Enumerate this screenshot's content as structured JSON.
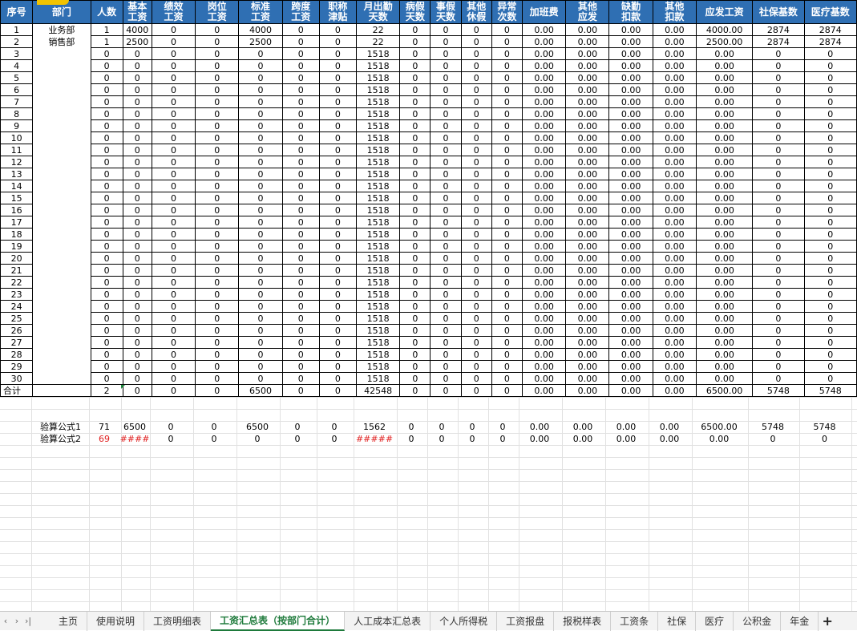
{
  "header": {
    "cols": [
      [
        "序号"
      ],
      [
        "部门"
      ],
      [
        "人数"
      ],
      [
        "基本",
        "工资"
      ],
      [
        "绩效",
        "工资"
      ],
      [
        "岗位",
        "工资"
      ],
      [
        "标准",
        "工资"
      ],
      [
        "跨度",
        "工资"
      ],
      [
        "职称",
        "津贴"
      ],
      [
        "月出勤",
        "天数"
      ],
      [
        "病假",
        "天数"
      ],
      [
        "事假",
        "天数"
      ],
      [
        "其他",
        "休假"
      ],
      [
        "异常",
        "次数"
      ],
      [
        "加班费"
      ],
      [
        "其他",
        "应发"
      ],
      [
        "缺勤",
        "扣款"
      ],
      [
        "其他",
        "扣款"
      ],
      [
        "应发工资"
      ],
      [
        "社保基数"
      ],
      [
        "医疗基数"
      ]
    ]
  },
  "rows": [
    [
      "1",
      "业务部",
      "1",
      "4000",
      "0",
      "0",
      "4000",
      "0",
      "0",
      "22",
      "0",
      "0",
      "0",
      "0",
      "0.00",
      "0.00",
      "0.00",
      "0.00",
      "4000.00",
      "2874",
      "2874"
    ],
    [
      "2",
      "销售部",
      "1",
      "2500",
      "0",
      "0",
      "2500",
      "0",
      "0",
      "22",
      "0",
      "0",
      "0",
      "0",
      "0.00",
      "0.00",
      "0.00",
      "0.00",
      "2500.00",
      "2874",
      "2874"
    ],
    [
      "3",
      "",
      "0",
      "0",
      "0",
      "0",
      "0",
      "0",
      "0",
      "1518",
      "0",
      "0",
      "0",
      "0",
      "0.00",
      "0.00",
      "0.00",
      "0.00",
      "0.00",
      "0",
      "0"
    ],
    [
      "4",
      "",
      "0",
      "0",
      "0",
      "0",
      "0",
      "0",
      "0",
      "1518",
      "0",
      "0",
      "0",
      "0",
      "0.00",
      "0.00",
      "0.00",
      "0.00",
      "0.00",
      "0",
      "0"
    ],
    [
      "5",
      "",
      "0",
      "0",
      "0",
      "0",
      "0",
      "0",
      "0",
      "1518",
      "0",
      "0",
      "0",
      "0",
      "0.00",
      "0.00",
      "0.00",
      "0.00",
      "0.00",
      "0",
      "0"
    ],
    [
      "6",
      "",
      "0",
      "0",
      "0",
      "0",
      "0",
      "0",
      "0",
      "1518",
      "0",
      "0",
      "0",
      "0",
      "0.00",
      "0.00",
      "0.00",
      "0.00",
      "0.00",
      "0",
      "0"
    ],
    [
      "7",
      "",
      "0",
      "0",
      "0",
      "0",
      "0",
      "0",
      "0",
      "1518",
      "0",
      "0",
      "0",
      "0",
      "0.00",
      "0.00",
      "0.00",
      "0.00",
      "0.00",
      "0",
      "0"
    ],
    [
      "8",
      "",
      "0",
      "0",
      "0",
      "0",
      "0",
      "0",
      "0",
      "1518",
      "0",
      "0",
      "0",
      "0",
      "0.00",
      "0.00",
      "0.00",
      "0.00",
      "0.00",
      "0",
      "0"
    ],
    [
      "9",
      "",
      "0",
      "0",
      "0",
      "0",
      "0",
      "0",
      "0",
      "1518",
      "0",
      "0",
      "0",
      "0",
      "0.00",
      "0.00",
      "0.00",
      "0.00",
      "0.00",
      "0",
      "0"
    ],
    [
      "10",
      "",
      "0",
      "0",
      "0",
      "0",
      "0",
      "0",
      "0",
      "1518",
      "0",
      "0",
      "0",
      "0",
      "0.00",
      "0.00",
      "0.00",
      "0.00",
      "0.00",
      "0",
      "0"
    ],
    [
      "11",
      "",
      "0",
      "0",
      "0",
      "0",
      "0",
      "0",
      "0",
      "1518",
      "0",
      "0",
      "0",
      "0",
      "0.00",
      "0.00",
      "0.00",
      "0.00",
      "0.00",
      "0",
      "0"
    ],
    [
      "12",
      "",
      "0",
      "0",
      "0",
      "0",
      "0",
      "0",
      "0",
      "1518",
      "0",
      "0",
      "0",
      "0",
      "0.00",
      "0.00",
      "0.00",
      "0.00",
      "0.00",
      "0",
      "0"
    ],
    [
      "13",
      "",
      "0",
      "0",
      "0",
      "0",
      "0",
      "0",
      "0",
      "1518",
      "0",
      "0",
      "0",
      "0",
      "0.00",
      "0.00",
      "0.00",
      "0.00",
      "0.00",
      "0",
      "0"
    ],
    [
      "14",
      "",
      "0",
      "0",
      "0",
      "0",
      "0",
      "0",
      "0",
      "1518",
      "0",
      "0",
      "0",
      "0",
      "0.00",
      "0.00",
      "0.00",
      "0.00",
      "0.00",
      "0",
      "0"
    ],
    [
      "15",
      "",
      "0",
      "0",
      "0",
      "0",
      "0",
      "0",
      "0",
      "1518",
      "0",
      "0",
      "0",
      "0",
      "0.00",
      "0.00",
      "0.00",
      "0.00",
      "0.00",
      "0",
      "0"
    ],
    [
      "16",
      "",
      "0",
      "0",
      "0",
      "0",
      "0",
      "0",
      "0",
      "1518",
      "0",
      "0",
      "0",
      "0",
      "0.00",
      "0.00",
      "0.00",
      "0.00",
      "0.00",
      "0",
      "0"
    ],
    [
      "17",
      "",
      "0",
      "0",
      "0",
      "0",
      "0",
      "0",
      "0",
      "1518",
      "0",
      "0",
      "0",
      "0",
      "0.00",
      "0.00",
      "0.00",
      "0.00",
      "0.00",
      "0",
      "0"
    ],
    [
      "18",
      "",
      "0",
      "0",
      "0",
      "0",
      "0",
      "0",
      "0",
      "1518",
      "0",
      "0",
      "0",
      "0",
      "0.00",
      "0.00",
      "0.00",
      "0.00",
      "0.00",
      "0",
      "0"
    ],
    [
      "19",
      "",
      "0",
      "0",
      "0",
      "0",
      "0",
      "0",
      "0",
      "1518",
      "0",
      "0",
      "0",
      "0",
      "0.00",
      "0.00",
      "0.00",
      "0.00",
      "0.00",
      "0",
      "0"
    ],
    [
      "20",
      "",
      "0",
      "0",
      "0",
      "0",
      "0",
      "0",
      "0",
      "1518",
      "0",
      "0",
      "0",
      "0",
      "0.00",
      "0.00",
      "0.00",
      "0.00",
      "0.00",
      "0",
      "0"
    ],
    [
      "21",
      "",
      "0",
      "0",
      "0",
      "0",
      "0",
      "0",
      "0",
      "1518",
      "0",
      "0",
      "0",
      "0",
      "0.00",
      "0.00",
      "0.00",
      "0.00",
      "0.00",
      "0",
      "0"
    ],
    [
      "22",
      "",
      "0",
      "0",
      "0",
      "0",
      "0",
      "0",
      "0",
      "1518",
      "0",
      "0",
      "0",
      "0",
      "0.00",
      "0.00",
      "0.00",
      "0.00",
      "0.00",
      "0",
      "0"
    ],
    [
      "23",
      "",
      "0",
      "0",
      "0",
      "0",
      "0",
      "0",
      "0",
      "1518",
      "0",
      "0",
      "0",
      "0",
      "0.00",
      "0.00",
      "0.00",
      "0.00",
      "0.00",
      "0",
      "0"
    ],
    [
      "24",
      "",
      "0",
      "0",
      "0",
      "0",
      "0",
      "0",
      "0",
      "1518",
      "0",
      "0",
      "0",
      "0",
      "0.00",
      "0.00",
      "0.00",
      "0.00",
      "0.00",
      "0",
      "0"
    ],
    [
      "25",
      "",
      "0",
      "0",
      "0",
      "0",
      "0",
      "0",
      "0",
      "1518",
      "0",
      "0",
      "0",
      "0",
      "0.00",
      "0.00",
      "0.00",
      "0.00",
      "0.00",
      "0",
      "0"
    ],
    [
      "26",
      "",
      "0",
      "0",
      "0",
      "0",
      "0",
      "0",
      "0",
      "1518",
      "0",
      "0",
      "0",
      "0",
      "0.00",
      "0.00",
      "0.00",
      "0.00",
      "0.00",
      "0",
      "0"
    ],
    [
      "27",
      "",
      "0",
      "0",
      "0",
      "0",
      "0",
      "0",
      "0",
      "1518",
      "0",
      "0",
      "0",
      "0",
      "0.00",
      "0.00",
      "0.00",
      "0.00",
      "0.00",
      "0",
      "0"
    ],
    [
      "28",
      "",
      "0",
      "0",
      "0",
      "0",
      "0",
      "0",
      "0",
      "1518",
      "0",
      "0",
      "0",
      "0",
      "0.00",
      "0.00",
      "0.00",
      "0.00",
      "0.00",
      "0",
      "0"
    ],
    [
      "29",
      "",
      "0",
      "0",
      "0",
      "0",
      "0",
      "0",
      "0",
      "1518",
      "0",
      "0",
      "0",
      "0",
      "0.00",
      "0.00",
      "0.00",
      "0.00",
      "0.00",
      "0",
      "0"
    ],
    [
      "30",
      "",
      "0",
      "0",
      "0",
      "0",
      "0",
      "0",
      "0",
      "1518",
      "0",
      "0",
      "0",
      "0",
      "0.00",
      "0.00",
      "0.00",
      "0.00",
      "0.00",
      "0",
      "0"
    ]
  ],
  "total": [
    "合计",
    "",
    "2",
    "0",
    "0",
    "0",
    "6500",
    "0",
    "0",
    "42548",
    "0",
    "0",
    "0",
    "0",
    "0.00",
    "0.00",
    "0.00",
    "0.00",
    "6500.00",
    "5748",
    "5748"
  ],
  "calc1": {
    "label": "验算公式1",
    "values": [
      "71",
      "6500",
      "0",
      "0",
      "6500",
      "0",
      "0",
      "1562",
      "0",
      "0",
      "0",
      "0",
      "0.00",
      "0.00",
      "0.00",
      "0.00",
      "6500.00",
      "5748",
      "5748"
    ]
  },
  "calc2": {
    "label": "验算公式2",
    "values": [
      "69",
      "####",
      "0",
      "0",
      "0",
      "0",
      "0",
      "#####",
      "0",
      "0",
      "0",
      "0",
      "0.00",
      "0.00",
      "0.00",
      "0.00",
      "0.00",
      "0",
      "0"
    ],
    "red_indexes": [
      0,
      1,
      7
    ]
  },
  "tabs": {
    "nav": [
      "‹",
      "›",
      "›|"
    ],
    "items": [
      "主页",
      "使用说明",
      "工资明细表",
      "工资汇总表（按部门合计）",
      "人工成本汇总表",
      "个人所得税",
      "工资报盘",
      "报税样表",
      "工资条",
      "社保",
      "医疗",
      "公积金",
      "年金"
    ],
    "active_index": 3,
    "add_label": "+"
  },
  "colors": {
    "header_bg": "#2f6fb3",
    "active_tab": "#1e7a3b",
    "error_text": "#e02020"
  }
}
